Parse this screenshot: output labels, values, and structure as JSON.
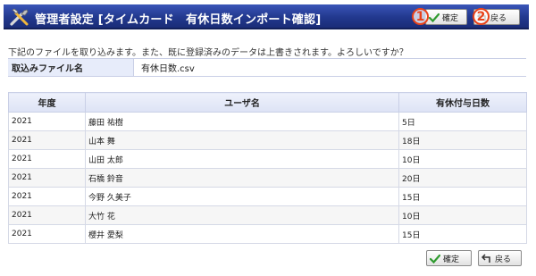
{
  "header": {
    "title": "管理者設定 [タイムカード　有休日数インポート確認]",
    "confirm_label": "確定",
    "back_label": "戻る",
    "marker_1": "1",
    "marker_2": "2"
  },
  "message": "下記のファイルを取り込みます。また、既に登録済みのデータは上書きされます。よろしいですか？",
  "file": {
    "label": "取込みファイル名",
    "value": "有休日数.csv"
  },
  "table": {
    "headers": [
      "年度",
      "ユーザ名",
      "有休付与日数"
    ],
    "rows": [
      [
        "2021",
        "藤田 祐樹",
        "5日"
      ],
      [
        "2021",
        "山本 舞",
        "18日"
      ],
      [
        "2021",
        "山田 太郎",
        "10日"
      ],
      [
        "2021",
        "石橋 鈴音",
        "20日"
      ],
      [
        "2021",
        "今野 久美子",
        "15日"
      ],
      [
        "2021",
        "大竹 花",
        "10日"
      ],
      [
        "2021",
        "櫻井 愛梨",
        "15日"
      ]
    ]
  },
  "footer": {
    "confirm_label": "確定",
    "back_label": "戻る"
  },
  "colors": {
    "header_bg": "#22388e",
    "marker": "#e8421a",
    "check": "#2e9a2e",
    "label_bg": "#e7ecfa"
  },
  "icons": {
    "header": "tools-icon",
    "confirm": "check-icon",
    "back": "back-arrow-icon"
  }
}
